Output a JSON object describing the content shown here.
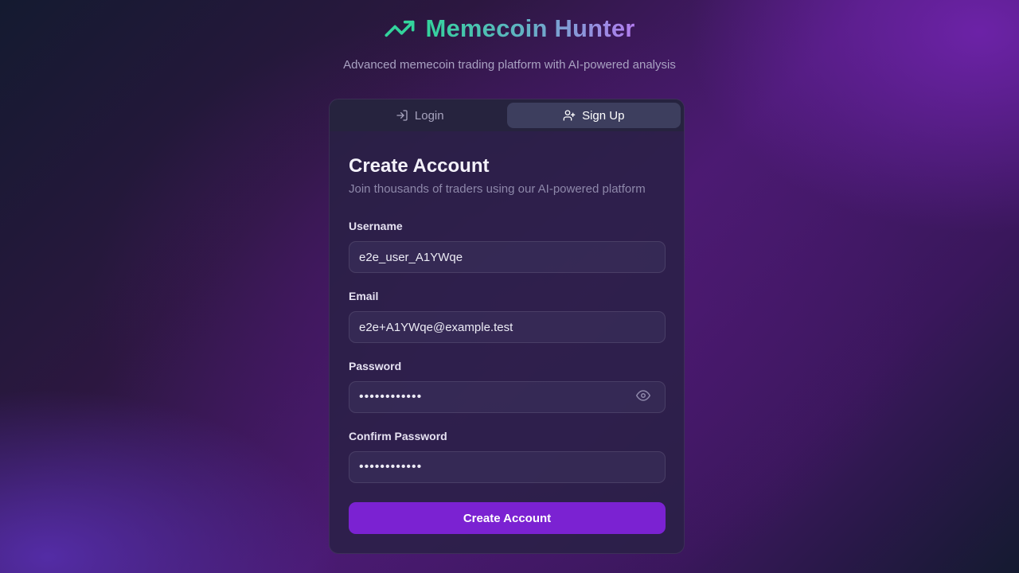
{
  "brand": {
    "title": "Memecoin Hunter",
    "subtitle": "Advanced memecoin trading platform with AI-powered analysis",
    "icon": "trending-up-icon",
    "icon_color": "#33d39c"
  },
  "tabs": [
    {
      "label": "Login",
      "icon": "log-in-icon",
      "active": false
    },
    {
      "label": "Sign Up",
      "icon": "user-plus-icon",
      "active": true
    }
  ],
  "form": {
    "title": "Create Account",
    "description": "Join thousands of traders using our AI-powered platform",
    "fields": {
      "username": {
        "label": "Username",
        "value": "e2e_user_A1YWqe"
      },
      "email": {
        "label": "Email",
        "value": "e2e+A1YWqe@example.test"
      },
      "password": {
        "label": "Password",
        "value": "••••••••••••"
      },
      "confirm": {
        "label": "Confirm Password",
        "value": "••••••••••••"
      }
    },
    "submit_label": "Create Account"
  },
  "colors": {
    "accent": "#7b22d2",
    "brand_gradient_start": "#33d39c",
    "brand_gradient_end": "#b37cf0"
  }
}
